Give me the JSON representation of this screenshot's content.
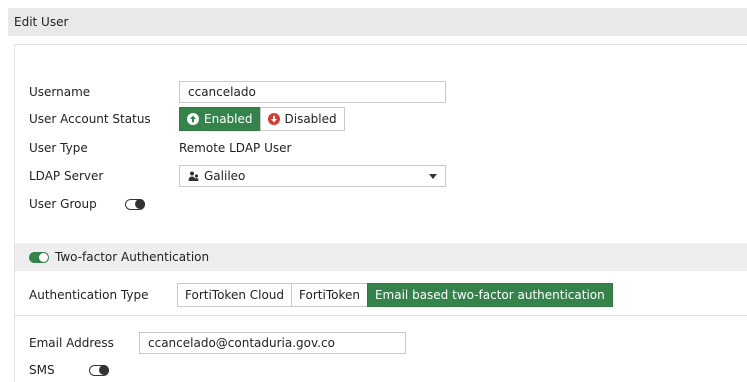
{
  "header": {
    "title": "Edit User"
  },
  "form": {
    "username_label": "Username",
    "username_value": "ccancelado",
    "status_label": "User Account Status",
    "status_enabled": "Enabled",
    "status_disabled": "Disabled",
    "user_type_label": "User Type",
    "user_type_value": "Remote LDAP User",
    "ldap_label": "LDAP Server",
    "ldap_value": "Galileo",
    "ldap_icon": "ldap-server-icon",
    "user_group_label": "User Group",
    "user_group_enabled": false
  },
  "two_factor": {
    "section_label": "Two-factor Authentication",
    "enabled": true,
    "auth_type_label": "Authentication Type",
    "auth_options": [
      "FortiToken Cloud",
      "FortiToken",
      "Email based two-factor authentication"
    ],
    "selected_option": "Email based two-factor authentication",
    "email_label": "Email Address",
    "email_value": "ccancelado@contaduria.gov.co",
    "sms_label": "SMS",
    "sms_enabled": false
  },
  "colors": {
    "accent_green": "#33834a",
    "enabled_icon": "#ffffff",
    "disabled_icon": "#d83a2e",
    "header_bg": "#e9e9e9"
  }
}
